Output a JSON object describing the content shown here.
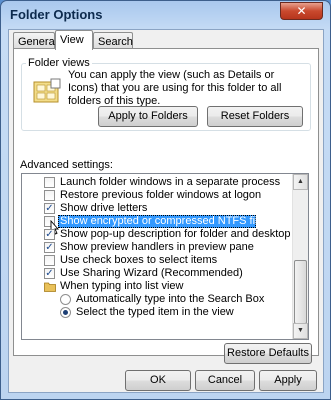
{
  "window": {
    "title": "Folder Options",
    "close_glyph": "✕"
  },
  "tabs": [
    {
      "label": "General",
      "active": false
    },
    {
      "label": "View",
      "active": true
    },
    {
      "label": "Search",
      "active": false
    }
  ],
  "folder_views": {
    "label": "Folder views",
    "description": "You can apply the view (such as Details or Icons) that you are using for this folder to all folders of this type.",
    "apply_button": "Apply to Folders",
    "reset_button": "Reset Folders"
  },
  "advanced": {
    "label": "Advanced settings:",
    "items": [
      {
        "type": "checkbox",
        "label": "Launch folder windows in a separate process",
        "checked": false
      },
      {
        "type": "checkbox",
        "label": "Restore previous folder windows at logon",
        "checked": false
      },
      {
        "type": "checkbox",
        "label": "Show drive letters",
        "checked": true
      },
      {
        "type": "checkbox",
        "label": "Show encrypted or compressed NTFS files in color",
        "checked": false,
        "selected": true
      },
      {
        "type": "checkbox",
        "label": "Show pop-up description for folder and desktop items",
        "checked": true
      },
      {
        "type": "checkbox",
        "label": "Show preview handlers in preview pane",
        "checked": true
      },
      {
        "type": "checkbox",
        "label": "Use check boxes to select items",
        "checked": false
      },
      {
        "type": "checkbox",
        "label": "Use Sharing Wizard (Recommended)",
        "checked": true
      },
      {
        "type": "folder",
        "label": "When typing into list view",
        "icon": "folder-icon"
      },
      {
        "type": "radio",
        "label": "Automatically type into the Search Box",
        "checked": false
      },
      {
        "type": "radio",
        "label": "Select the typed item in the view",
        "checked": true
      }
    ],
    "restore_button": "Restore Defaults"
  },
  "footer": {
    "ok": "OK",
    "cancel": "Cancel",
    "apply": "Apply"
  },
  "colors": {
    "selection": "#3399ff",
    "title_bar": "#a9c8ee",
    "close": "#c9492e"
  }
}
